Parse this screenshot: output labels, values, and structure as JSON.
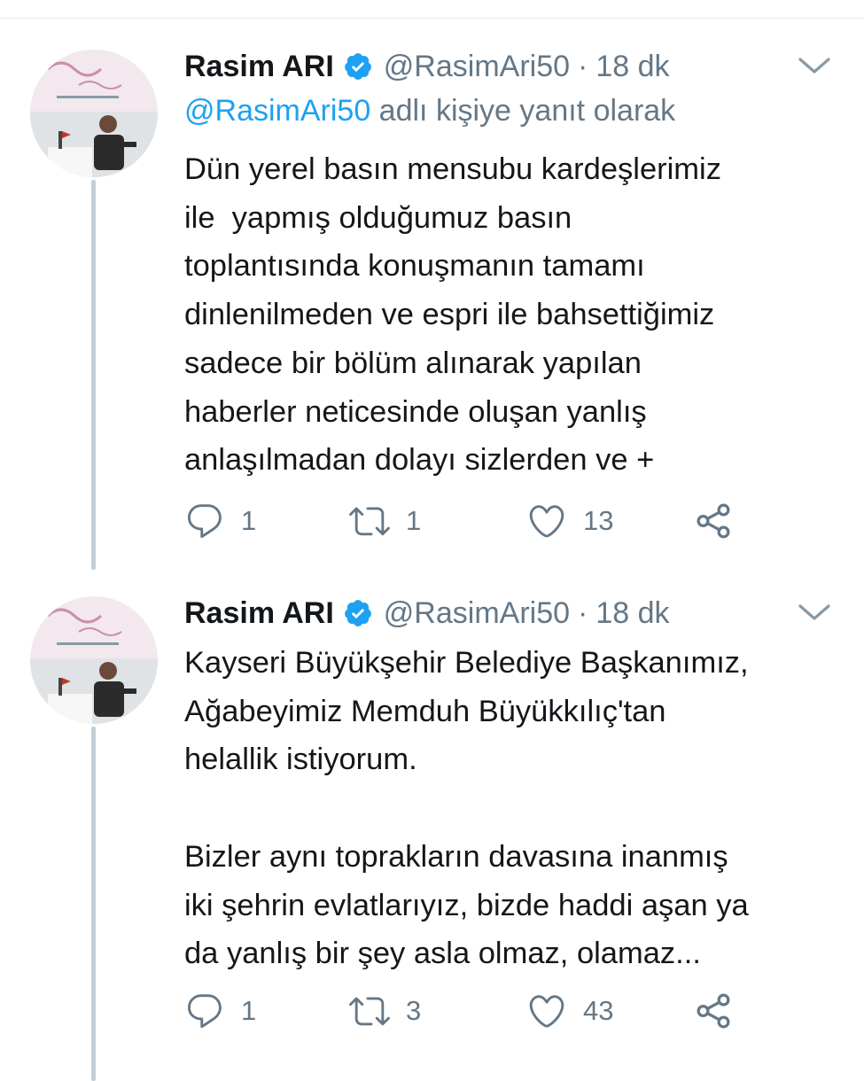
{
  "colors": {
    "accent": "#1da1f2",
    "secondary_text": "#657786",
    "thread_line": "#c4cfd6"
  },
  "tweets": [
    {
      "author_name": "Rasim ARI",
      "verified": true,
      "handle": "@RasimAri50",
      "separator": "·",
      "time": "18 dk",
      "reply_to": {
        "mention": "@RasimAri50",
        "suffix": " adlı kişiye yanıt olarak"
      },
      "text": "Dün yerel basın mensubu kardeşlerimiz\nile  yapmış olduğumuz basın\ntoplantısında konuşmanın tamamı\ndinlenilmeden ve espri ile bahsettiğimiz\nsadece bir bölüm alınarak yapılan\nhaberler neticesinde oluşan yanlış\nanlaşılmadan dolayı sizlerden ve +",
      "replies": "1",
      "retweets": "1",
      "likes": "13"
    },
    {
      "author_name": "Rasim ARI",
      "verified": true,
      "handle": "@RasimAri50",
      "separator": "·",
      "time": "18 dk",
      "text": "Kayseri Büyükşehir Belediye Başkanımız,\nAğabeyimiz Memduh Büyükkılıç'tan\nhelallik istiyorum.\n\nBizler aynı toprakların davasına inanmış\niki şehrin evlatlarıyız, bizde haddi aşan ya\nda yanlış bir şey asla olmaz, olamaz...",
      "replies": "1",
      "retweets": "3",
      "likes": "43"
    }
  ]
}
